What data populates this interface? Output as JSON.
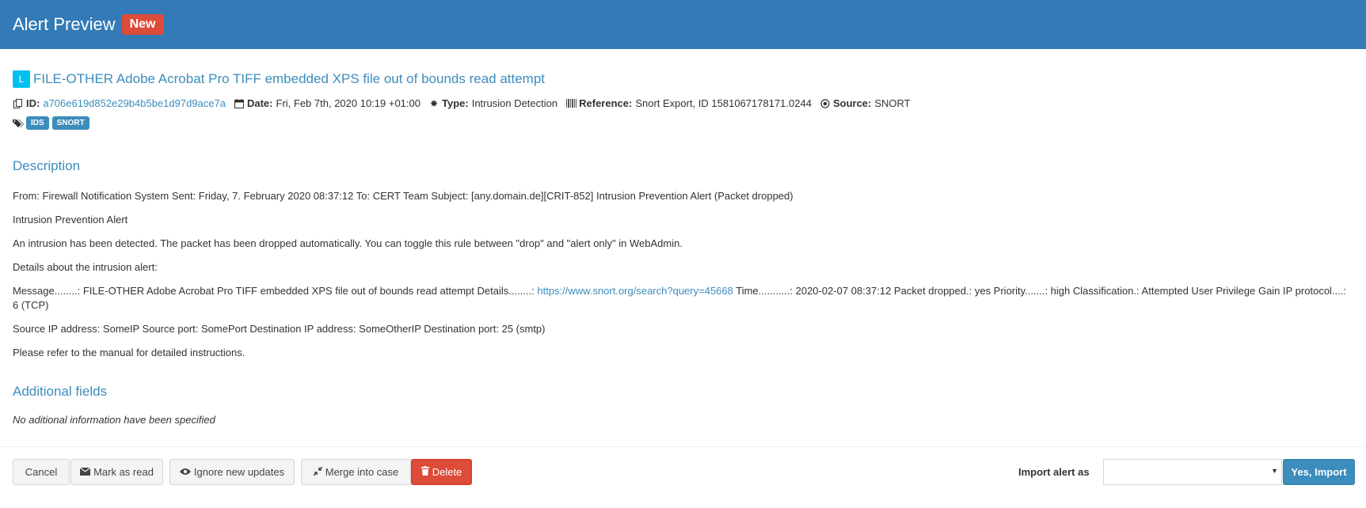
{
  "header": {
    "title": "Alert Preview",
    "badge": "New"
  },
  "alert": {
    "severity_letter": "L",
    "title": "FILE-OTHER Adobe Acrobat Pro TIFF embedded XPS file out of bounds read attempt",
    "meta": {
      "id_label": "ID:",
      "id_value": "a706e619d852e29b4b5be1d97d9ace7a",
      "date_label": "Date:",
      "date_value": "Fri, Feb 7th, 2020 10:19 +01:00",
      "type_label": "Type:",
      "type_value": "Intrusion Detection",
      "reference_label": "Reference:",
      "reference_value": "Snort Export, ID 1581067178171.0244",
      "source_label": "Source:",
      "source_value": "SNORT"
    },
    "tags": [
      "IDS",
      "SNORT"
    ]
  },
  "description": {
    "title": "Description",
    "para1": "From: Firewall Notification System Sent: Friday, 7. February 2020 08:37:12 To: CERT Team Subject: [any.domain.de][CRIT-852] Intrusion Prevention Alert (Packet dropped)",
    "para2": "Intrusion Prevention Alert",
    "para3": "An intrusion has been detected. The packet has been dropped automatically. You can toggle this rule between \"drop\" and \"alert only\" in WebAdmin.",
    "para4": "Details about the intrusion alert:",
    "para5_pre": "Message........: FILE-OTHER Adobe Acrobat Pro TIFF embedded XPS file out of bounds read attempt Details........: ",
    "para5_link": "https://www.snort.org/search?query=45668",
    "para5_post": " Time...........: 2020-02-07 08:37:12 Packet dropped.: yes Priority.......: high Classification.: Attempted User Privilege Gain IP protocol....: 6 (TCP)",
    "para6": "Source IP address: SomeIP Source port: SomePort Destination IP address: SomeOtherIP Destination port: 25 (smtp)",
    "para7": "Please refer to the manual for detailed instructions."
  },
  "additional": {
    "title": "Additional fields",
    "empty_text": "No aditional information have been specified"
  },
  "footer": {
    "cancel": "Cancel",
    "mark_read": "Mark as read",
    "ignore_updates": "Ignore new updates",
    "merge": "Merge into case",
    "delete": "Delete",
    "import_label": "Import alert as",
    "select_value": "",
    "import_button": "Yes, Import"
  },
  "colors": {
    "header_bg": "#337ab7",
    "link": "#3c8dbc",
    "danger": "#dd4b39",
    "info": "#00c0ef"
  }
}
